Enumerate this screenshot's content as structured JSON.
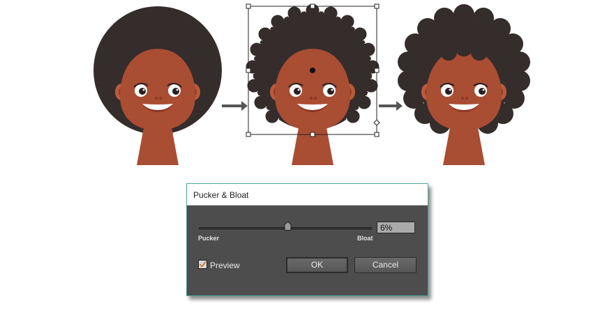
{
  "dialog": {
    "title": "Pucker & Bloat",
    "slider": {
      "value_text": "6%",
      "min_label": "Pucker",
      "max_label": "Bloat",
      "fraction": 0.515
    },
    "preview": {
      "label": "Preview",
      "checked": true
    },
    "buttons": {
      "ok": "OK",
      "cancel": "Cancel"
    }
  },
  "colors": {
    "hair": "#352c2c",
    "skin": "#a94d33",
    "ear_skin": "#b95a3b",
    "mouth_lip": "#8c3523",
    "dialog_bg": "#4d4d4d",
    "dialog_border": "#4aa89a",
    "check_mark": "#c8832e"
  },
  "icons": {
    "arrow_1": "right-arrow-icon",
    "arrow_2": "right-arrow-icon",
    "checkbox": "check-icon",
    "slider_thumb": "slider-thumb-icon"
  }
}
